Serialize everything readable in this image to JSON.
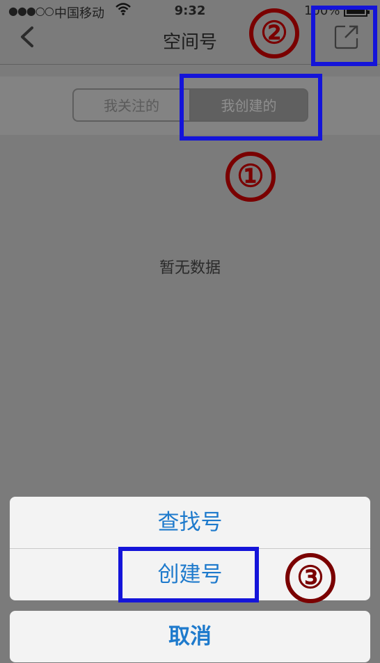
{
  "status_bar": {
    "signal": "●●●○○",
    "carrier": "中国移动",
    "time": "9:32",
    "battery_text": "100%"
  },
  "nav": {
    "title": "空间号",
    "back_icon": "chevron-left-icon",
    "share_icon": "share-external-icon"
  },
  "segments": {
    "follow": "我关注的",
    "created": "我创建的",
    "selected": "created"
  },
  "empty_text": "暂无数据",
  "annotations": {
    "one": "①",
    "two": "②",
    "three": "③",
    "highlight_color": "#1414d9",
    "circle_color": "#7a0000"
  },
  "action_sheet": {
    "find": "查找号",
    "create": "创建号",
    "cancel": "取消"
  },
  "colors": {
    "action_text": "#1e7acc"
  }
}
